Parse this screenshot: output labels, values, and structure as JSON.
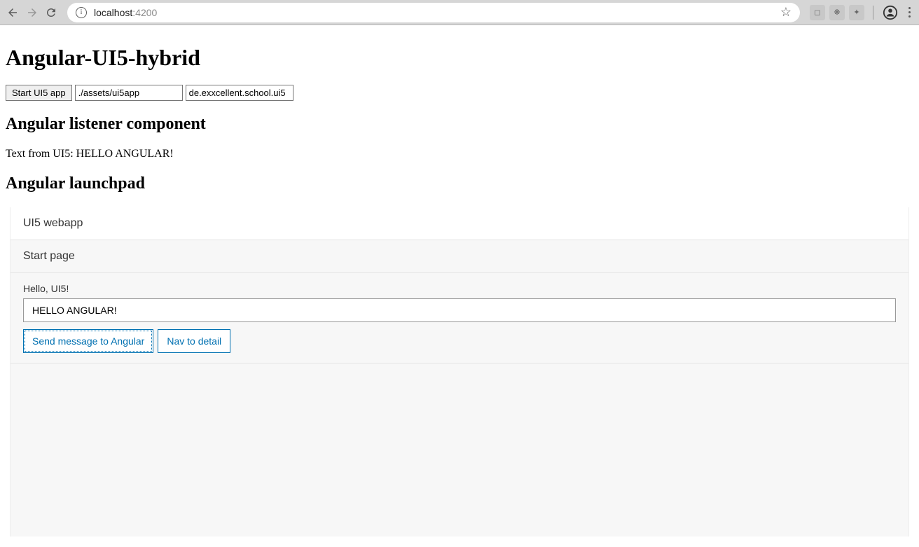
{
  "browser": {
    "url_host": "localhost",
    "url_port": ":4200"
  },
  "page": {
    "title": "Angular-UI5-hybrid",
    "start_button": "Start UI5 app",
    "asset_path": "./assets/ui5app",
    "namespace": "de.exxcellent.school.ui5",
    "listener_heading": "Angular listener component",
    "listener_text_prefix": "Text from UI5: ",
    "listener_text_value": "HELLO ANGULAR!",
    "launchpad_heading": "Angular launchpad"
  },
  "ui5": {
    "app_title": "UI5 webapp",
    "page_title": "Start page",
    "greeting_label": "Hello, UI5!",
    "input_value": "HELLO ANGULAR!",
    "send_button": "Send message to Angular",
    "nav_button": "Nav to detail"
  }
}
